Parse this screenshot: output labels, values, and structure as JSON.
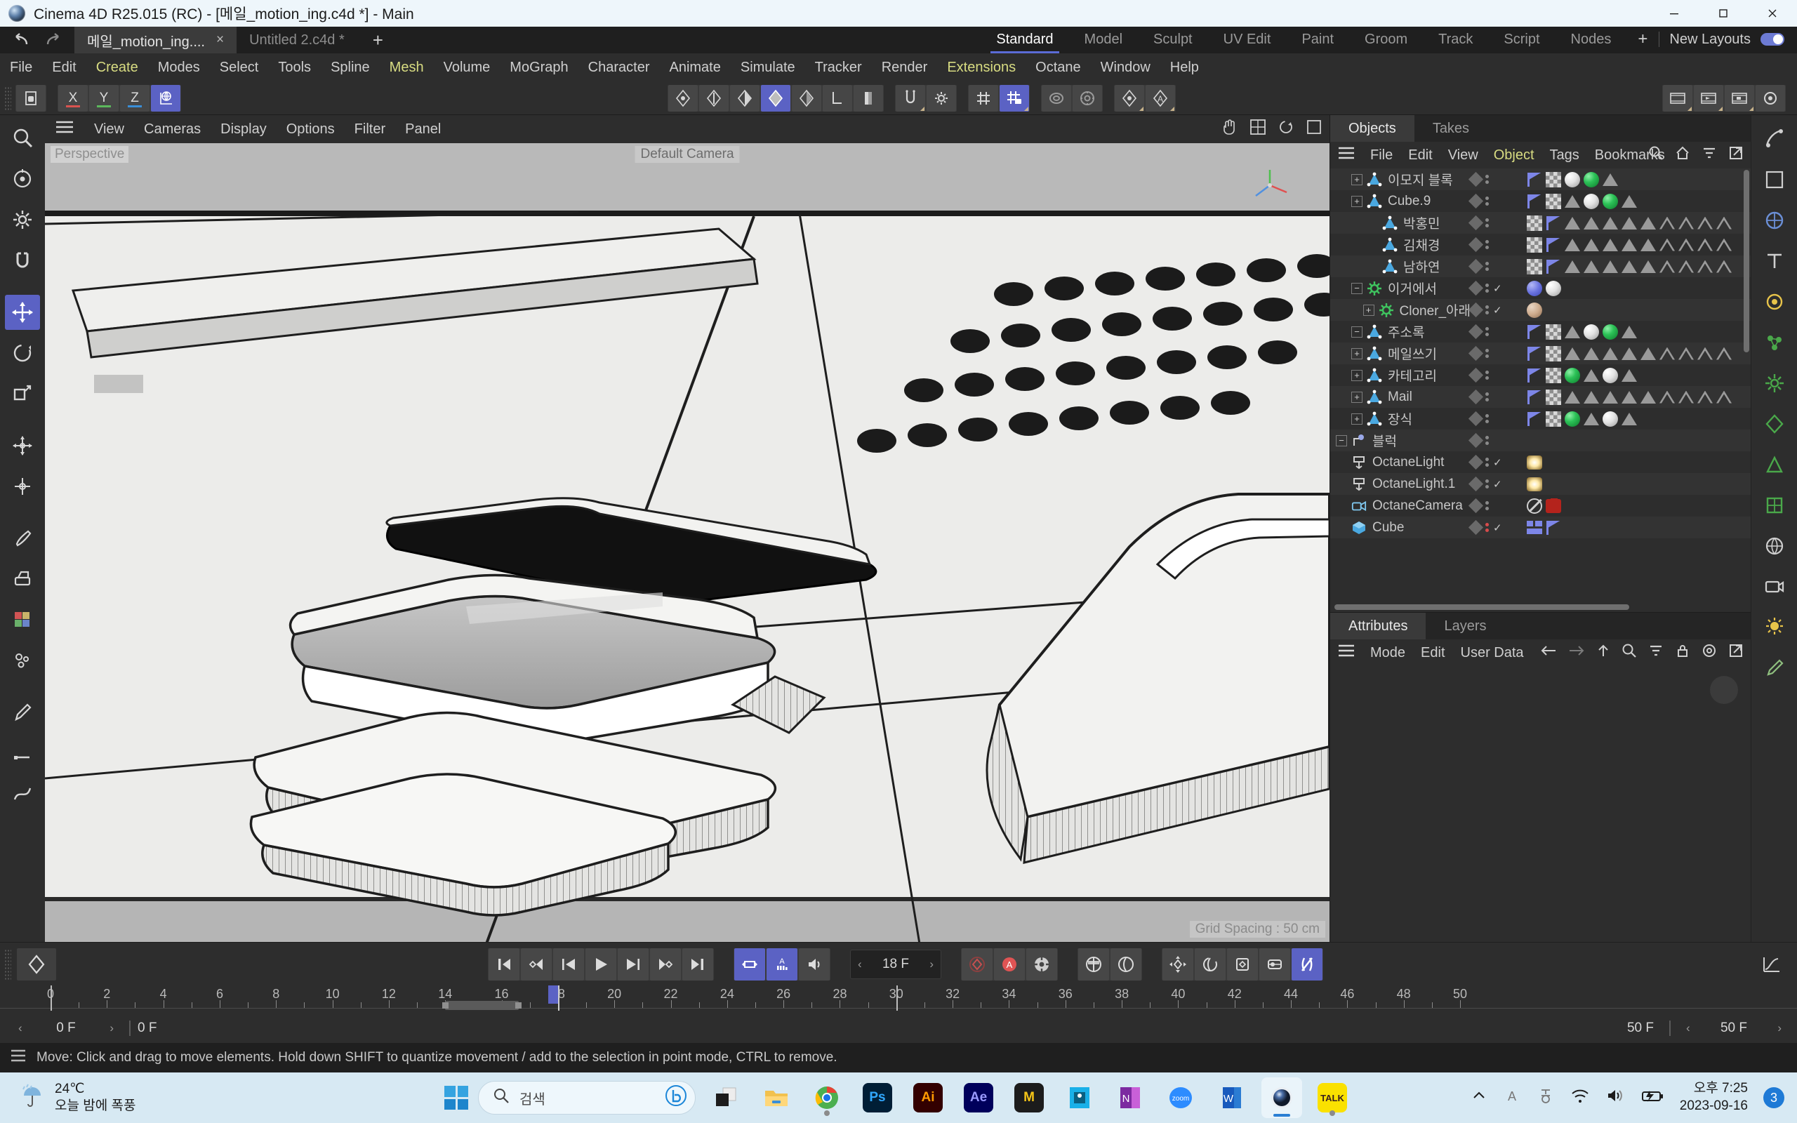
{
  "window": {
    "title": "Cinema 4D R25.015 (RC) - [메일_motion_ing.c4d *] - Main",
    "minimize": "─",
    "maximize": "☐",
    "close": "✕"
  },
  "doc_tabs": [
    {
      "label": "메일_motion_ing....",
      "close": "×",
      "active": true
    },
    {
      "label": "Untitled 2.c4d *",
      "active": false
    }
  ],
  "tab_add": "+",
  "menu": [
    {
      "label": "File",
      "highlight": false
    },
    {
      "label": "Edit",
      "highlight": false
    },
    {
      "label": "Create",
      "highlight": true
    },
    {
      "label": "Modes",
      "highlight": false
    },
    {
      "label": "Select",
      "highlight": false
    },
    {
      "label": "Tools",
      "highlight": false
    },
    {
      "label": "Spline",
      "highlight": false
    },
    {
      "label": "Mesh",
      "highlight": true
    },
    {
      "label": "Volume",
      "highlight": false
    },
    {
      "label": "MoGraph",
      "highlight": false
    },
    {
      "label": "Character",
      "highlight": false
    },
    {
      "label": "Animate",
      "highlight": false
    },
    {
      "label": "Simulate",
      "highlight": false
    },
    {
      "label": "Tracker",
      "highlight": false
    },
    {
      "label": "Render",
      "highlight": false
    },
    {
      "label": "Extensions",
      "highlight": true
    },
    {
      "label": "Octane",
      "highlight": false
    },
    {
      "label": "Window",
      "highlight": false
    },
    {
      "label": "Help",
      "highlight": false
    }
  ],
  "layouts": {
    "tabs": [
      {
        "label": "Standard",
        "active": true
      },
      {
        "label": "Model",
        "active": false
      },
      {
        "label": "Sculpt",
        "active": false
      },
      {
        "label": "UV Edit",
        "active": false
      },
      {
        "label": "Paint",
        "active": false
      },
      {
        "label": "Groom",
        "active": false
      },
      {
        "label": "Track",
        "active": false
      },
      {
        "label": "Script",
        "active": false
      },
      {
        "label": "Nodes",
        "active": false
      }
    ],
    "add": "+",
    "new_layouts_label": "New Layouts"
  },
  "toolbar": {
    "axis_x": "X",
    "axis_y": "Y",
    "axis_z": "Z"
  },
  "viewport": {
    "menu": [
      "View",
      "Cameras",
      "Display",
      "Options",
      "Filter",
      "Panel"
    ],
    "label": "Perspective",
    "camera_label": "Default Camera",
    "grid_spacing": "Grid Spacing : 50 cm",
    "hud_value": ""
  },
  "objects_panel": {
    "tabs": [
      {
        "label": "Objects",
        "active": true
      },
      {
        "label": "Takes",
        "active": false
      }
    ],
    "menu": [
      {
        "label": "File",
        "highlight": false
      },
      {
        "label": "Edit",
        "highlight": false
      },
      {
        "label": "View",
        "highlight": false
      },
      {
        "label": "Object",
        "highlight": true
      },
      {
        "label": "Tags",
        "highlight": false
      },
      {
        "label": "Bookmarks",
        "highlight": false
      }
    ],
    "rows": [
      {
        "label": "Cube",
        "indent": 0,
        "expander": "none",
        "icon": "cube",
        "check": true,
        "dots": "red",
        "tags": [
          "grid",
          "flag"
        ]
      },
      {
        "label": "OctaneCamera",
        "indent": 0,
        "expander": "none",
        "icon": "camera",
        "check": false,
        "dots": "gray",
        "tags": [
          "forbid",
          "camtag"
        ]
      },
      {
        "label": "OctaneLight.1",
        "indent": 0,
        "expander": "none",
        "icon": "light",
        "check": true,
        "dots": "gray",
        "tags": [
          "lighttag"
        ]
      },
      {
        "label": "OctaneLight",
        "indent": 0,
        "expander": "none",
        "icon": "light",
        "check": true,
        "dots": "gray",
        "tags": [
          "lighttag"
        ]
      },
      {
        "label": "블럭",
        "indent": 0,
        "expander": "minus",
        "icon": "null",
        "check": false,
        "dots": "gray",
        "tags": []
      },
      {
        "label": "장식",
        "indent": 1,
        "expander": "plus",
        "icon": "poly",
        "check": false,
        "dots": "gray",
        "tags": [
          "flag",
          "checker",
          "green",
          "tri",
          "white",
          "tri"
        ]
      },
      {
        "label": "Mail",
        "indent": 1,
        "expander": "plus",
        "icon": "poly",
        "check": false,
        "dots": "gray",
        "tags": [
          "flag",
          "checker",
          "tri",
          "tri",
          "tri",
          "tri",
          "tri",
          "htri",
          "htri",
          "htri",
          "htri"
        ]
      },
      {
        "label": "카테고리",
        "indent": 1,
        "expander": "plus",
        "icon": "poly",
        "check": false,
        "dots": "gray",
        "tags": [
          "flag",
          "checker",
          "green",
          "tri",
          "white",
          "tri"
        ]
      },
      {
        "label": "메일쓰기",
        "indent": 1,
        "expander": "plus",
        "icon": "poly",
        "check": false,
        "dots": "gray",
        "tags": [
          "flag",
          "checker",
          "tri",
          "tri",
          "tri",
          "tri",
          "tri",
          "htri",
          "htri",
          "htri",
          "htri"
        ]
      },
      {
        "label": "주소록",
        "indent": 1,
        "expander": "minus",
        "icon": "poly",
        "check": false,
        "dots": "gray",
        "tags": [
          "flag",
          "checker",
          "tri",
          "white",
          "green",
          "tri"
        ]
      },
      {
        "label": "Cloner_아래",
        "indent": 2,
        "expander": "plus",
        "icon": "cloner",
        "check": true,
        "dots": "gray",
        "tags": [
          "tan"
        ]
      },
      {
        "label": "이거에서",
        "indent": 1,
        "expander": "minus",
        "icon": "cloner",
        "check": true,
        "dots": "gray",
        "tags": [
          "purple",
          "white"
        ]
      },
      {
        "label": "남하연",
        "indent": 2,
        "expander": "none",
        "icon": "poly",
        "check": false,
        "dots": "gray",
        "tags": [
          "checker",
          "flag",
          "tri",
          "tri",
          "tri",
          "tri",
          "tri",
          "htri",
          "htri",
          "htri",
          "htri"
        ]
      },
      {
        "label": "김채경",
        "indent": 2,
        "expander": "none",
        "icon": "poly",
        "check": false,
        "dots": "gray",
        "tags": [
          "checker",
          "flag",
          "tri",
          "tri",
          "tri",
          "tri",
          "tri",
          "htri",
          "htri",
          "htri",
          "htri"
        ]
      },
      {
        "label": "박홍민",
        "indent": 2,
        "expander": "none",
        "icon": "poly",
        "check": false,
        "dots": "gray",
        "tags": [
          "checker",
          "flag",
          "tri",
          "tri",
          "tri",
          "tri",
          "tri",
          "htri",
          "htri",
          "htri",
          "htri"
        ]
      },
      {
        "label": "Cube.9",
        "indent": 1,
        "expander": "plus",
        "icon": "poly",
        "check": false,
        "dots": "gray",
        "tags": [
          "flag",
          "checker",
          "tri",
          "white",
          "green",
          "tri"
        ]
      },
      {
        "label": "이모지 블록",
        "indent": 1,
        "expander": "plus",
        "icon": "poly",
        "check": false,
        "dots": "gray",
        "tags": [
          "flag",
          "checker",
          "white",
          "green",
          "tri"
        ]
      }
    ]
  },
  "attributes_panel": {
    "tabs": [
      {
        "label": "Attributes",
        "active": true
      },
      {
        "label": "Layers",
        "active": false
      }
    ],
    "menu": [
      "Mode",
      "Edit",
      "User Data"
    ]
  },
  "timeline": {
    "current_frame": "18 F",
    "start_frame": "0 F",
    "preview_start": "0 F",
    "preview_end": "50 F",
    "end_frame": "50 F",
    "ruler_ticks": [
      0,
      2,
      4,
      6,
      8,
      10,
      12,
      14,
      16,
      18,
      20,
      22,
      24,
      26,
      28,
      30,
      32,
      34,
      36,
      38,
      40,
      42,
      44,
      46,
      48,
      50
    ],
    "playhead_frame": 18,
    "range_min": 0,
    "range_max": 50
  },
  "status": {
    "message": "Move: Click and drag to move elements. Hold down SHIFT to quantize movement / add to the selection in point mode, CTRL to remove."
  },
  "taskbar": {
    "weather_temp": "24℃",
    "weather_desc": "오늘 밤에 폭풍",
    "search_placeholder": "검색",
    "apps": [
      {
        "name": "task-view",
        "kind": "taskview",
        "state": "none"
      },
      {
        "name": "file-explorer",
        "kind": "explorer",
        "state": "none"
      },
      {
        "name": "google-chrome",
        "kind": "chrome",
        "state": "dot"
      },
      {
        "name": "photoshop",
        "kind": "ps",
        "label": "Ps",
        "state": "none"
      },
      {
        "name": "illustrator",
        "kind": "ai",
        "label": "Ai",
        "state": "none"
      },
      {
        "name": "after-effects",
        "kind": "ae",
        "label": "Ae",
        "state": "none"
      },
      {
        "name": "miricanvas",
        "kind": "m",
        "label": "M",
        "state": "none"
      },
      {
        "name": "notion-clip",
        "kind": "blue",
        "state": "none"
      },
      {
        "name": "onenote",
        "kind": "n",
        "label": "N",
        "state": "none"
      },
      {
        "name": "zoom",
        "kind": "zoom",
        "label": "zoom",
        "state": "none"
      },
      {
        "name": "word",
        "kind": "w",
        "label": "W",
        "state": "none"
      },
      {
        "name": "cinema4d",
        "kind": "c4d",
        "state": "active"
      },
      {
        "name": "kakaotalk",
        "kind": "talk",
        "label": "TALK",
        "state": "dot"
      }
    ],
    "clock_time": "오후 7:25",
    "clock_date": "2023-09-16",
    "notification_count": "3"
  },
  "colors": {
    "accent": "#5b62c4",
    "menu_highlight": "#d8dc82",
    "panel_bg": "#2d2d2d",
    "viewport_bg": "#ececea"
  }
}
